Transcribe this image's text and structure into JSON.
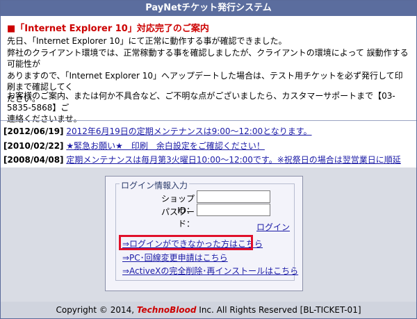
{
  "header": {
    "title": "PayNetチケット発行システム"
  },
  "notice": {
    "title": "■「Internet Explorer 10」対応完了のご案内",
    "lines": [
      "先日、「Internet Explorer 10」にて正常に動作する事が確認できました。",
      "弊社のクライアント環境では、正常稼動する事を確認しましたが、クライアントの環境によって 誤動作する可能性が",
      "ありますので、「Internet Explorer 10」へアップデートした場合は、テスト用チケットを必ず発行して印刷まで確認してく",
      "ださい。"
    ],
    "support_lines": [
      "お客様のご案内、または何か不具合など、ご不明な点がございましたら、カスタマーサポートまで【03-5835-5868】ご",
      "連絡くださいませ。"
    ]
  },
  "news": [
    {
      "date": "[2012/06/19]",
      "text": "2012年6月19日の定期メンテナンスは9:00～12:00となります。"
    },
    {
      "date": "[2010/02/22]",
      "text": "★緊急お願い★　印刷　余白設定をご確認ください！"
    },
    {
      "date": "[2008/04/08]",
      "text": "定期メンテナンスは毎月第3火曜日10:00～12:00です。※祝祭日の場合は翌営業日に順延"
    }
  ],
  "login": {
    "legend": "ログイン情報入力",
    "shop_id_label": "ショップID：",
    "shop_id_value": "",
    "password_label": "パスワード：",
    "password_value": "",
    "login_label": "ログイン",
    "links": [
      "⇒ログインができなかった方はこちら",
      "⇒PC･回線変更申請はこちら",
      "⇒ActiveXの完全削除･再インストールはこちら"
    ]
  },
  "footer": {
    "prefix": "Copyright © 2014, ",
    "brand": "TechnoBlood",
    "suffix": " Inc. All Rights Reserved [BL-TICKET-01]"
  },
  "colors": {
    "header_bg": "#5b6d9e",
    "notice_red": "#cc0000",
    "link_blue": "#1a1aa6",
    "highlight_red": "#e0102a"
  }
}
